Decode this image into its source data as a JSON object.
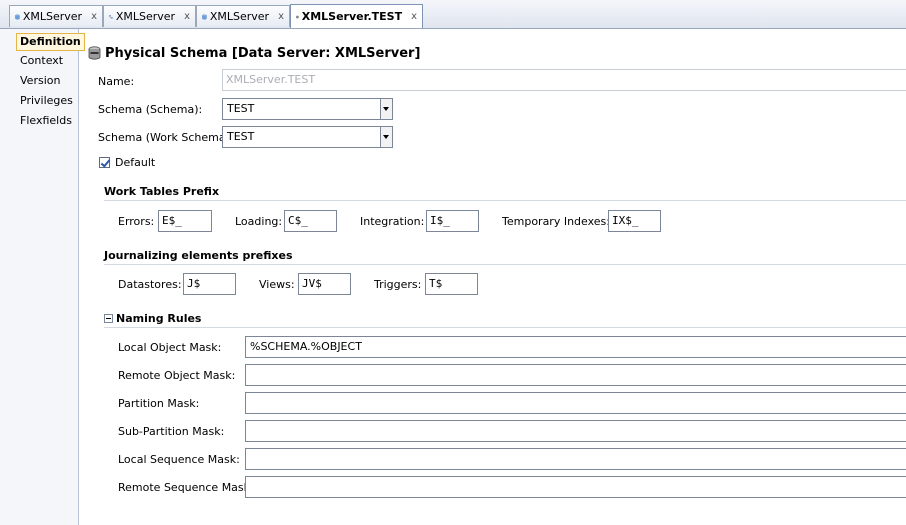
{
  "tabs": [
    {
      "label": "XMLServer",
      "close": "x",
      "icon": "database-icon"
    },
    {
      "label": "XMLServer",
      "close": "x",
      "icon": "data-model-icon"
    },
    {
      "label": "XMLServer",
      "close": "x",
      "icon": "database-icon"
    },
    {
      "label": "XMLServer.TEST",
      "close": "x",
      "icon": "physical-schema-icon",
      "active": true
    }
  ],
  "nav": [
    "Definition",
    "Context",
    "Version",
    "Privileges",
    "Flexfields"
  ],
  "header": {
    "title": "Physical Schema [Data Server: XMLServer]"
  },
  "form": {
    "name_label": "Name:",
    "name_value": "XMLServer.TEST",
    "schema_label": "Schema (Schema):",
    "schema_value": "TEST",
    "work_schema_label": "Schema (Work Schema):",
    "work_schema_value": "TEST",
    "default_label": "Default",
    "default_checked": true
  },
  "work_tables": {
    "title": "Work Tables Prefix",
    "errors_label": "Errors:",
    "errors_value": "E$_",
    "loading_label": "Loading:",
    "loading_value": "C$_",
    "integration_label": "Integration:",
    "integration_value": "I$_",
    "temp_label": "Temporary Indexes:",
    "temp_value": "IX$_"
  },
  "journalizing": {
    "title": "Journalizing elements prefixes",
    "datastores_label": "Datastores:",
    "datastores_value": "J$",
    "views_label": "Views:",
    "views_value": "JV$",
    "triggers_label": "Triggers:",
    "triggers_value": "T$"
  },
  "naming_rules": {
    "title": "Naming Rules",
    "rows": [
      {
        "label": "Local Object Mask:",
        "value": "%SCHEMA.%OBJECT"
      },
      {
        "label": "Remote Object Mask:",
        "value": ""
      },
      {
        "label": "Partition Mask:",
        "value": ""
      },
      {
        "label": "Sub-Partition Mask:",
        "value": ""
      },
      {
        "label": "Local Sequence Mask:",
        "value": ""
      },
      {
        "label": "Remote Sequence Mask:",
        "value": ""
      }
    ]
  },
  "colors": {
    "accent": "#e2b44a",
    "tab_border": "#9aa8bd",
    "icon_blue": "#5b8fd6"
  }
}
